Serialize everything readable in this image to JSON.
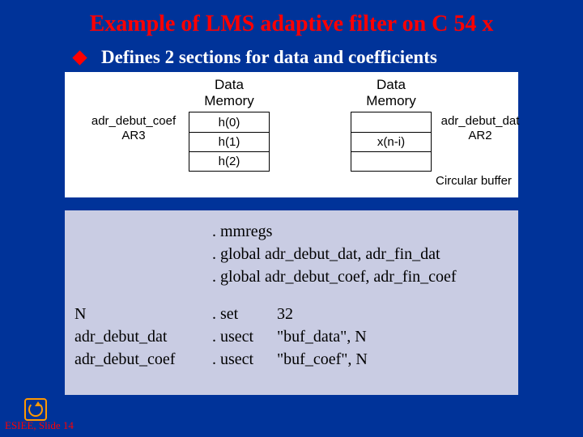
{
  "title": "Example of LMS adaptive filter on C 54 x",
  "subtitle": "Defines 2 sections for data and coefficients",
  "diagram": {
    "header_left": "Data\nMemory",
    "header_right": "Data\nMemory",
    "left_cells": [
      "h(0)",
      "h(1)",
      "h(2)"
    ],
    "right_cells": [
      "",
      "x(n-i)",
      ""
    ],
    "label_left_line1": "adr_debut_coef",
    "label_left_line2": "AR3",
    "label_right_line1": "adr_debut_dat",
    "label_right_line2": "AR2",
    "circular_label": "Circular buffer"
  },
  "code": {
    "directives_top": [
      ". mmregs",
      ". global adr_debut_dat, adr_fin_dat",
      ". global adr_debut_coef, adr_fin_coef"
    ],
    "rows": [
      {
        "label": "N",
        "directive": ". set",
        "arg": "32"
      },
      {
        "label": "adr_debut_dat",
        "directive": ". usect",
        "arg": "\"buf_data\", N"
      },
      {
        "label": "adr_debut_coef",
        "directive": ". usect",
        "arg": "\"buf_coef\", N"
      }
    ]
  },
  "footer": "ESIEE, Slide 14"
}
